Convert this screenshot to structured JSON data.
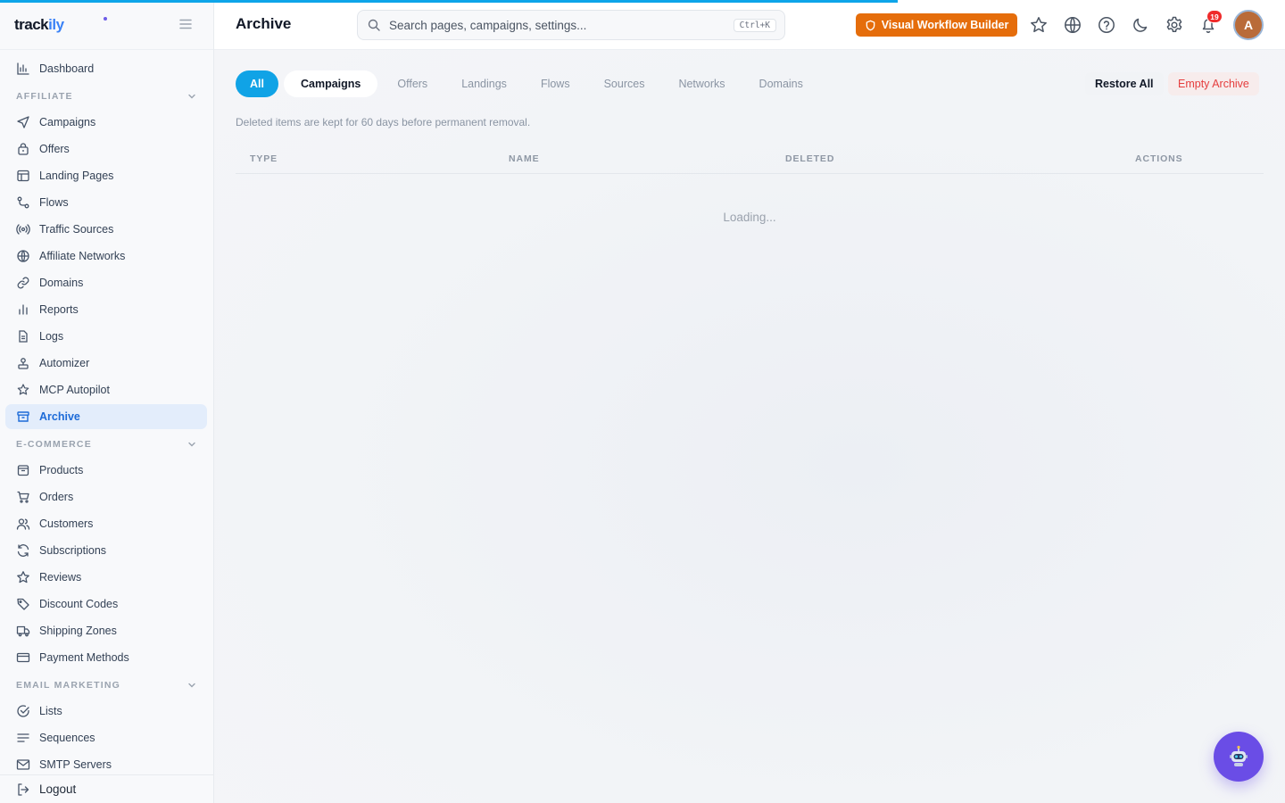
{
  "app": {
    "logo_prefix": "track",
    "logo_suffix": "ily"
  },
  "page": {
    "title": "Archive"
  },
  "search": {
    "placeholder": "Search pages, campaigns, settings...",
    "shortcut": "Ctrl+K"
  },
  "header": {
    "workflow_button": "Visual Workflow Builder",
    "notification_count": "19",
    "avatar_initial": "A",
    "icons": [
      "star-icon",
      "globe-icon",
      "help-icon",
      "moon-icon",
      "gear-icon",
      "bell-icon"
    ]
  },
  "sidebar": {
    "dashboard": "Dashboard",
    "sections": [
      {
        "title": "AFFILIATE",
        "items": [
          {
            "label": "Campaigns",
            "icon": "send-icon"
          },
          {
            "label": "Offers",
            "icon": "lock-bag-icon"
          },
          {
            "label": "Landing Pages",
            "icon": "layout-icon"
          },
          {
            "label": "Flows",
            "icon": "route-icon"
          },
          {
            "label": "Traffic Sources",
            "icon": "broadcast-icon"
          },
          {
            "label": "Affiliate Networks",
            "icon": "globe-icon"
          },
          {
            "label": "Domains",
            "icon": "link-icon"
          },
          {
            "label": "Reports",
            "icon": "bar-chart-icon"
          },
          {
            "label": "Logs",
            "icon": "file-text-icon"
          },
          {
            "label": "Automizer",
            "icon": "robot-arm-icon"
          },
          {
            "label": "MCP Autopilot",
            "icon": "sparkle-star-icon"
          },
          {
            "label": "Archive",
            "icon": "archive-icon",
            "active": true
          }
        ]
      },
      {
        "title": "E-COMMERCE",
        "items": [
          {
            "label": "Products",
            "icon": "package-icon"
          },
          {
            "label": "Orders",
            "icon": "cart-icon"
          },
          {
            "label": "Customers",
            "icon": "users-icon"
          },
          {
            "label": "Subscriptions",
            "icon": "refresh-icon"
          },
          {
            "label": "Reviews",
            "icon": "star-icon"
          },
          {
            "label": "Discount Codes",
            "icon": "tag-icon"
          },
          {
            "label": "Shipping Zones",
            "icon": "truck-icon"
          },
          {
            "label": "Payment Methods",
            "icon": "credit-card-icon"
          }
        ]
      },
      {
        "title": "EMAIL MARKETING",
        "items": [
          {
            "label": "Lists",
            "icon": "check-circle-icon"
          },
          {
            "label": "Sequences",
            "icon": "lines-icon"
          },
          {
            "label": "SMTP Servers",
            "icon": "mail-icon"
          }
        ]
      }
    ],
    "logout": "Logout"
  },
  "tabs": [
    {
      "label": "All",
      "state": "active"
    },
    {
      "label": "Campaigns",
      "state": "selected"
    },
    {
      "label": "Offers"
    },
    {
      "label": "Landings"
    },
    {
      "label": "Flows"
    },
    {
      "label": "Sources"
    },
    {
      "label": "Networks"
    },
    {
      "label": "Domains"
    }
  ],
  "actions": {
    "restore_all": "Restore All",
    "empty_archive": "Empty Archive"
  },
  "notice": "Deleted items are kept for 60 days before permanent removal.",
  "table": {
    "columns": [
      "TYPE",
      "NAME",
      "DELETED",
      "ACTIONS"
    ],
    "loading_text": "Loading..."
  },
  "colors": {
    "accent": "#10a3e6",
    "workflow_button": "#e56d0b",
    "danger": "#e53e3e",
    "badge": "#ef2b2b",
    "bot_button": "#6a4de6"
  }
}
